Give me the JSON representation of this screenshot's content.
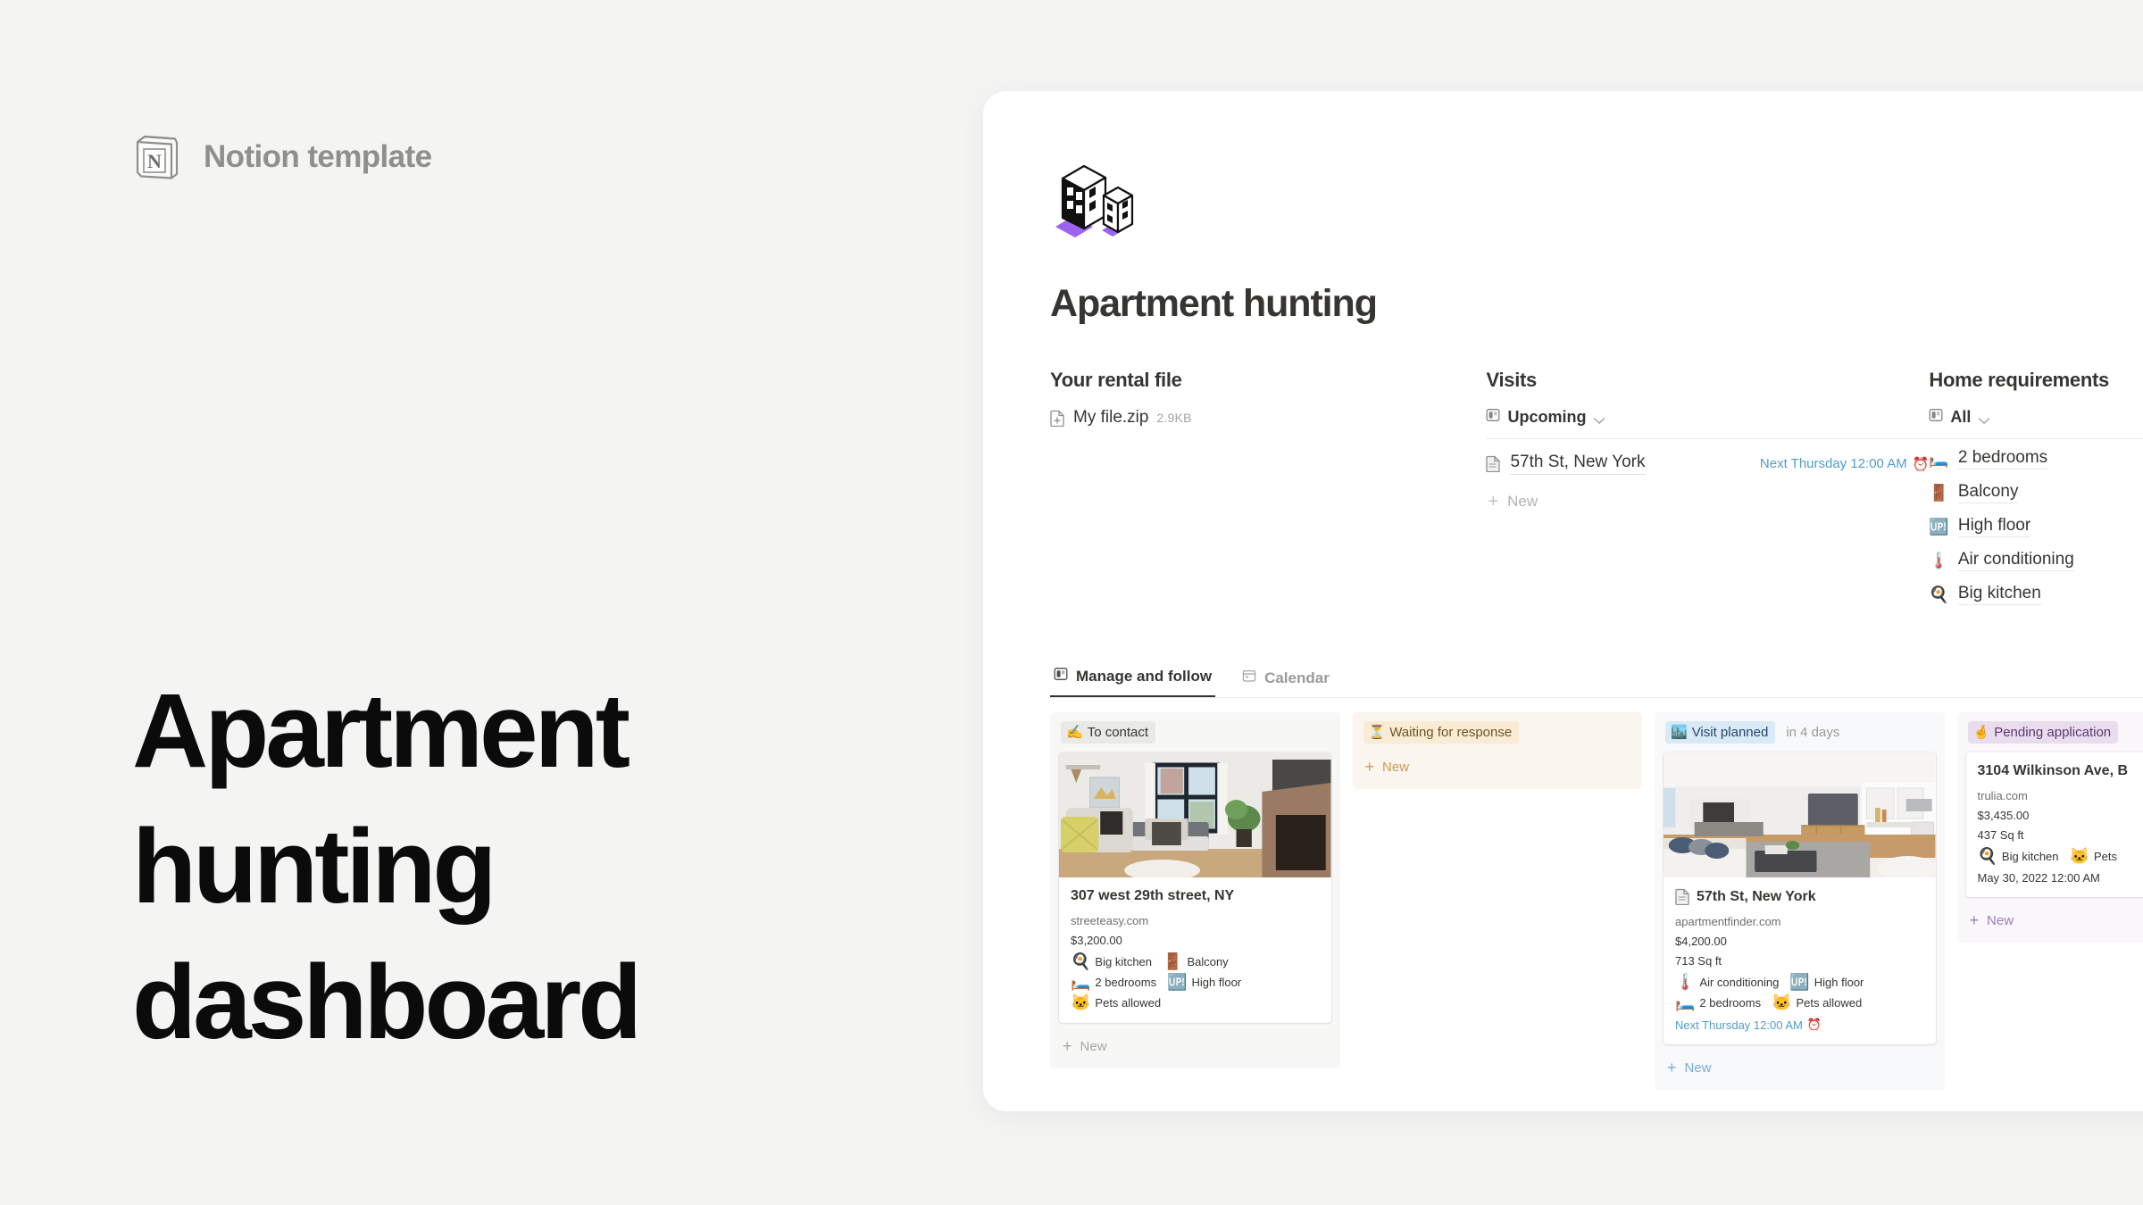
{
  "brand": {
    "label": "Notion template",
    "icon": "notion-cube-icon"
  },
  "hero": {
    "line1": "Apartment",
    "line2": "hunting",
    "line3": "dashboard"
  },
  "page": {
    "icon": "isometric-buildings-icon",
    "title": "Apartment hunting"
  },
  "rental_file": {
    "title": "Your rental file",
    "file_name": "My file.zip",
    "file_size": "2.9KB"
  },
  "visits": {
    "title": "Visits",
    "view": "Upcoming",
    "items": [
      {
        "name": "57th St, New York",
        "date": "Next Thursday 12:00 AM"
      }
    ],
    "new_label": "New"
  },
  "requirements": {
    "title": "Home requirements",
    "view": "All",
    "items": [
      {
        "emoji": "🛏️",
        "label": "2 bedrooms"
      },
      {
        "emoji": "🚪",
        "label": "Balcony"
      },
      {
        "emoji": "🆙",
        "label": "High floor"
      },
      {
        "emoji": "🌡️",
        "label": "Air conditioning"
      },
      {
        "emoji": "🍳",
        "label": "Big kitchen"
      }
    ]
  },
  "tabs": [
    {
      "label": "Manage and follow",
      "icon": "board-view-icon",
      "active": true
    },
    {
      "label": "Calendar",
      "icon": "calendar-view-icon",
      "active": false
    }
  ],
  "board": {
    "columns": [
      {
        "id": "to-contact",
        "emoji": "✍️",
        "label": "To contact",
        "meta": "",
        "new_label": "New",
        "cards": [
          {
            "image": "bedroom-photo",
            "title": "307 west 29th street, NY",
            "source": "streeteasy.com",
            "price": "$3,200.00",
            "area": "",
            "props": [
              {
                "emoji": "🍳",
                "label": "Big kitchen"
              },
              {
                "emoji": "🚪",
                "label": "Balcony"
              },
              {
                "emoji": "🛏️",
                "label": "2 bedrooms"
              },
              {
                "emoji": "🆙",
                "label": "High floor"
              },
              {
                "emoji": "🐱",
                "label": "Pets allowed"
              }
            ],
            "date": ""
          }
        ]
      },
      {
        "id": "waiting-for-response",
        "emoji": "⏳",
        "label": "Waiting for response",
        "meta": "",
        "new_label": "New",
        "cards": []
      },
      {
        "id": "visit-planned",
        "emoji": "🏙️",
        "label": "Visit planned",
        "meta": "in 4 days",
        "new_label": "New",
        "cards": [
          {
            "image": "living-room-photo",
            "title": "57th St, New York",
            "source": "apartmentfinder.com",
            "price": "$4,200.00",
            "area": "713 Sq ft",
            "props": [
              {
                "emoji": "🌡️",
                "label": "Air conditioning"
              },
              {
                "emoji": "🆙",
                "label": "High floor"
              },
              {
                "emoji": "🛏️",
                "label": "2 bedrooms"
              },
              {
                "emoji": "🐱",
                "label": "Pets allowed"
              }
            ],
            "date": "Next Thursday 12:00 AM"
          }
        ]
      },
      {
        "id": "pending-application",
        "emoji": "🤞",
        "label": "Pending application",
        "meta": "",
        "new_label": "New",
        "cards": [
          {
            "image": "",
            "title": "3104 Wilkinson Ave, B",
            "source": "trulia.com",
            "price": "$3,435.00",
            "area": "437 Sq ft",
            "props": [
              {
                "emoji": "🍳",
                "label": "Big kitchen"
              },
              {
                "emoji": "🐱",
                "label": "Pets"
              }
            ],
            "date": "May 30, 2022 12:00 AM"
          }
        ]
      }
    ]
  },
  "colors": {
    "page_bg": "#f4f4f3",
    "panel_bg": "#ffffff",
    "text": "#37352f",
    "muted": "#9b9a97",
    "blue_date": "#529cca",
    "accent_purple": "#9b63f0"
  }
}
